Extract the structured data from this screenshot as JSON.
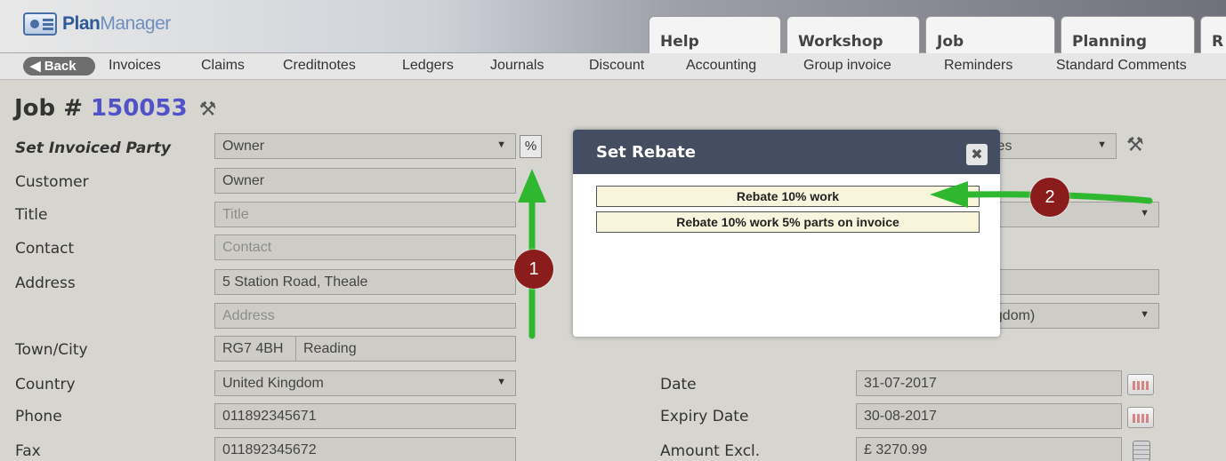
{
  "header": {
    "logo_plan": "Plan",
    "logo_manager": "Manager",
    "tabs": [
      "Help",
      "Workshop",
      "Job",
      "Planning",
      "R"
    ]
  },
  "nav": {
    "back": "◀ Back",
    "links": [
      "Invoices",
      "Claims",
      "Creditnotes",
      "Ledgers",
      "Journals",
      "Discount",
      "Accounting",
      "Group invoice",
      "Reminders",
      "Standard Comments"
    ]
  },
  "job": {
    "label": "Job #",
    "number": "150053"
  },
  "form": {
    "set_invoiced_party_label": "Set Invoiced Party",
    "set_invoiced_party_value": "Owner",
    "percent_button": "%",
    "customer_label": "Customer",
    "customer_value": "Owner",
    "title_label": "Title",
    "title_placeholder": "Title",
    "contact_label": "Contact",
    "contact_placeholder": "Contact",
    "address_label": "Address",
    "address_value": "5 Station Road, Theale",
    "address2_placeholder": "Address",
    "town_label": "Town/City",
    "postcode_value": "RG7 4BH",
    "town_value": "Reading",
    "country_label": "Country",
    "country_value": "United Kingdom",
    "phone_label": "Phone",
    "phone_value": "011892345671",
    "fax_label": "Fax",
    "fax_value": "011892345672"
  },
  "right_form": {
    "partial_select_1": "ices",
    "partial_select_3": "ngdom)",
    "date_label": "Date",
    "date_value": "31-07-2017",
    "expiry_label": "Expiry Date",
    "expiry_value": "30-08-2017",
    "amount_label": "Amount Excl.",
    "amount_value": "£ 3270.99"
  },
  "modal": {
    "title": "Set Rebate",
    "close": "✖",
    "options": [
      "Rebate 10% work",
      "Rebate 10% work 5% parts on invoice"
    ]
  },
  "annotations": {
    "badge_1": "1",
    "badge_2": "2"
  },
  "colors": {
    "arrow": "#2fb82f",
    "badge": "#8b1c1c",
    "job_number": "#5252c8",
    "modal_header": "#454d62"
  }
}
